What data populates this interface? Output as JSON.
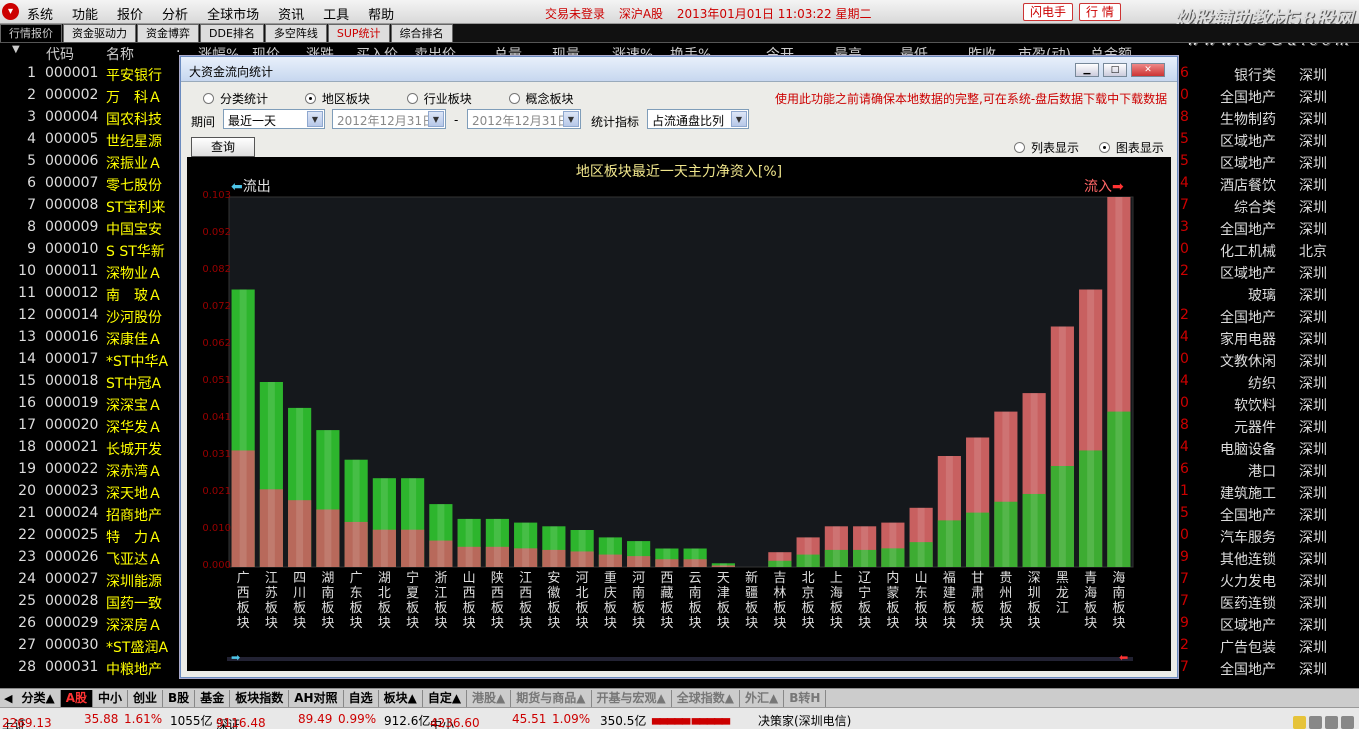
{
  "app": {
    "menu": [
      "系统",
      "功能",
      "报价",
      "分析",
      "全球市场",
      "资讯",
      "工具",
      "帮助"
    ],
    "status": {
      "login": "交易未登录",
      "market": "深沪A股",
      "datetime": "2013年01月01日 11:03:22 星期二"
    },
    "buttons": {
      "flash": "闪电手",
      "quote": "行 情"
    },
    "watermark": {
      "line1": "炒股辅助教材58股网",
      "line2": "www.58Gu.com"
    }
  },
  "tabs": [
    "行情报价",
    "资金驱动力",
    "资金博弈",
    "DDE排名",
    "多空阵线",
    "SUP统计",
    "综合排名"
  ],
  "active_tab": 0,
  "columns": [
    "代码",
    "名称",
    "·",
    "涨幅%",
    "现价",
    "涨跌",
    "买入价",
    "卖出价",
    "总量",
    "现量",
    "涨速%",
    "换手%",
    "今开",
    "最高",
    "最低",
    "昨收",
    "市盈(动)",
    "总金额"
  ],
  "rows": [
    {
      "idx": "1",
      "code": "000001",
      "name": "平安银行",
      "r": "6",
      "ind": "银行类",
      "area": "深圳"
    },
    {
      "idx": "2",
      "code": "000002",
      "name": "万　科Ａ",
      "r": "0",
      "ind": "全国地产",
      "area": "深圳"
    },
    {
      "idx": "3",
      "code": "000004",
      "name": "国农科技",
      "r": "8",
      "ind": "生物制药",
      "area": "深圳"
    },
    {
      "idx": "4",
      "code": "000005",
      "name": "世纪星源",
      "r": "5",
      "ind": "区域地产",
      "area": "深圳"
    },
    {
      "idx": "5",
      "code": "000006",
      "name": "深振业Ａ",
      "r": "5",
      "ind": "区域地产",
      "area": "深圳"
    },
    {
      "idx": "6",
      "code": "000007",
      "name": "零七股份",
      "r": "4",
      "ind": "酒店餐饮",
      "area": "深圳"
    },
    {
      "idx": "7",
      "code": "000008",
      "name": "ST宝利来",
      "r": "7",
      "ind": "综合类",
      "area": "深圳"
    },
    {
      "idx": "8",
      "code": "000009",
      "name": "中国宝安",
      "r": "3",
      "ind": "全国地产",
      "area": "深圳"
    },
    {
      "idx": "9",
      "code": "000010",
      "name": "S ST华新",
      "r": "0",
      "ind": "化工机械",
      "area": "北京"
    },
    {
      "idx": "10",
      "code": "000011",
      "name": "深物业Ａ",
      "r": "2",
      "ind": "区域地产",
      "area": "深圳"
    },
    {
      "idx": "11",
      "code": "000012",
      "name": "南　玻Ａ",
      "r": "",
      "ind": "玻璃",
      "area": "深圳"
    },
    {
      "idx": "12",
      "code": "000014",
      "name": "沙河股份",
      "r": "2",
      "ind": "全国地产",
      "area": "深圳"
    },
    {
      "idx": "13",
      "code": "000016",
      "name": "深康佳Ａ",
      "r": "4",
      "ind": "家用电器",
      "area": "深圳"
    },
    {
      "idx": "14",
      "code": "000017",
      "name": "*ST中华A",
      "r": "0",
      "ind": "文教休闲",
      "area": "深圳"
    },
    {
      "idx": "15",
      "code": "000018",
      "name": "ST中冠A",
      "r": "4",
      "ind": "纺织",
      "area": "深圳"
    },
    {
      "idx": "16",
      "code": "000019",
      "name": "深深宝Ａ",
      "r": "0",
      "ind": "软饮料",
      "area": "深圳"
    },
    {
      "idx": "17",
      "code": "000020",
      "name": "深华发Ａ",
      "r": "8",
      "ind": "元器件",
      "area": "深圳"
    },
    {
      "idx": "18",
      "code": "000021",
      "name": "长城开发",
      "r": "4",
      "ind": "电脑设备",
      "area": "深圳"
    },
    {
      "idx": "19",
      "code": "000022",
      "name": "深赤湾Ａ",
      "r": "6",
      "ind": "港口",
      "area": "深圳"
    },
    {
      "idx": "20",
      "code": "000023",
      "name": "深天地Ａ",
      "r": "1",
      "ind": "建筑施工",
      "area": "深圳"
    },
    {
      "idx": "21",
      "code": "000024",
      "name": "招商地产",
      "r": "5",
      "ind": "全国地产",
      "area": "深圳"
    },
    {
      "idx": "22",
      "code": "000025",
      "name": "特　力Ａ",
      "r": "0",
      "ind": "汽车服务",
      "area": "深圳"
    },
    {
      "idx": "23",
      "code": "000026",
      "name": "飞亚达Ａ",
      "r": "9",
      "ind": "其他连锁",
      "area": "深圳"
    },
    {
      "idx": "24",
      "code": "000027",
      "name": "深圳能源",
      "r": "7",
      "ind": "火力发电",
      "area": "深圳"
    },
    {
      "idx": "25",
      "code": "000028",
      "name": "国药一致",
      "r": "7",
      "ind": "医药连锁",
      "area": "深圳"
    },
    {
      "idx": "26",
      "code": "000029",
      "name": "深深房Ａ",
      "r": "9",
      "ind": "区域地产",
      "area": "深圳"
    },
    {
      "idx": "27",
      "code": "000030",
      "name": "*ST盛润A",
      "r": "2",
      "ind": "广告包装",
      "area": "深圳"
    },
    {
      "idx": "28",
      "code": "000031",
      "name": "中粮地产",
      "r": "7",
      "ind": "全国地产",
      "area": "深圳"
    }
  ],
  "bottom_tabs": [
    "分类▲",
    "A股",
    "中小",
    "创业",
    "B股",
    "基金",
    "板块指数",
    "AH对照",
    "自选",
    "板块▲",
    "自定▲",
    "港股▲",
    "期货与商品▲",
    "开基与宏观▲",
    "全球指数▲",
    "外汇▲",
    "B转H"
  ],
  "bottom_active": 1,
  "statusbar": {
    "sh_label": "上证",
    "sh_val": "2269.13",
    "sh_chg": "35.88",
    "sh_pct": "1.61%",
    "sh_amt": "1055亿",
    "sz_label": "深证",
    "sz_val": "9116.48",
    "sz_chg": "89.49",
    "sz_pct": "0.99%",
    "sz_amt": "912.6亿",
    "zx_label": "中小",
    "zx_val": "4236.60",
    "zx_chg": "45.51",
    "zx_pct": "1.09%",
    "zx_amt": "350.5亿",
    "bars": "▄▄▄▄▄ ▄▄▄▄▄",
    "server": "决策家(深圳电信)"
  },
  "dialog": {
    "title": "大资金流向统计",
    "radios": [
      {
        "label": "分类统计",
        "checked": false
      },
      {
        "label": "地区板块",
        "checked": true
      },
      {
        "label": "行业板块",
        "checked": false
      },
      {
        "label": "概念板块",
        "checked": false
      }
    ],
    "warning": "使用此功能之前请确保本地数据的完整,可在系统-盘后数据下载中下载数据",
    "period_label": "期间",
    "period_value": "最近一天",
    "date_from": "2012年12月31日",
    "date_sep": "-",
    "date_to": "2012年12月31日",
    "metric_label": "统计指标",
    "metric_value": "占流通盘比列",
    "query_button": "查询",
    "display_radios": [
      {
        "label": "列表显示",
        "checked": false
      },
      {
        "label": "图表显示",
        "checked": true
      }
    ]
  },
  "chart_data": {
    "type": "bar",
    "title": "地区板块最近一天主力净资入[%]",
    "outflow_label": "流出",
    "inflow_label": "流入",
    "ylim": [
      0,
      0.1
    ],
    "yticks": [
      "0.000",
      "0.010",
      "0.021",
      "0.031",
      "0.041",
      "0.051",
      "0.062",
      "0.072",
      "0.082",
      "0.092",
      "0.103"
    ],
    "categories": [
      "广西板块",
      "江苏板块",
      "四川板块",
      "湖南板块",
      "广东板块",
      "湖北板块",
      "宁夏板块",
      "浙江板块",
      "山西板块",
      "陕西板块",
      "江西板块",
      "安徽板块",
      "河北板块",
      "重庆板块",
      "河南板块",
      "西藏板块",
      "云南板块",
      "天津板块",
      "新疆板块",
      "吉林板块",
      "北京板块",
      "上海板块",
      "辽宁板块",
      "内蒙板块",
      "山东板块",
      "福建板块",
      "甘肃板块",
      "贵州板块",
      "深圳板块",
      "黑龙江",
      "青海板块",
      "海南板块"
    ],
    "series": [
      {
        "name": "流出",
        "color": "#2db52d",
        "values": [
          0.075,
          0.05,
          0.043,
          0.037,
          0.029,
          0.024,
          0.024,
          0.017,
          0.013,
          0.013,
          0.012,
          0.011,
          0.01,
          0.008,
          0.007,
          0.005,
          0.005,
          0.001,
          0.0,
          0.0,
          0.0,
          0.0,
          0.0,
          0.0,
          0.0,
          0.0,
          0.0,
          0.0,
          0.0,
          0.0,
          0.0,
          0.0
        ]
      },
      {
        "name": "流入",
        "color": "#c86060",
        "values": [
          0.0,
          0.0,
          0.0,
          0.0,
          0.0,
          0.0,
          0.0,
          0.0,
          0.0,
          0.0,
          0.0,
          0.0,
          0.0,
          0.0,
          0.0,
          0.0,
          0.0,
          0.0,
          0.0,
          0.004,
          0.008,
          0.011,
          0.011,
          0.012,
          0.016,
          0.03,
          0.035,
          0.042,
          0.047,
          0.065,
          0.075,
          0.1
        ]
      }
    ],
    "grid": false,
    "legend": "top"
  }
}
